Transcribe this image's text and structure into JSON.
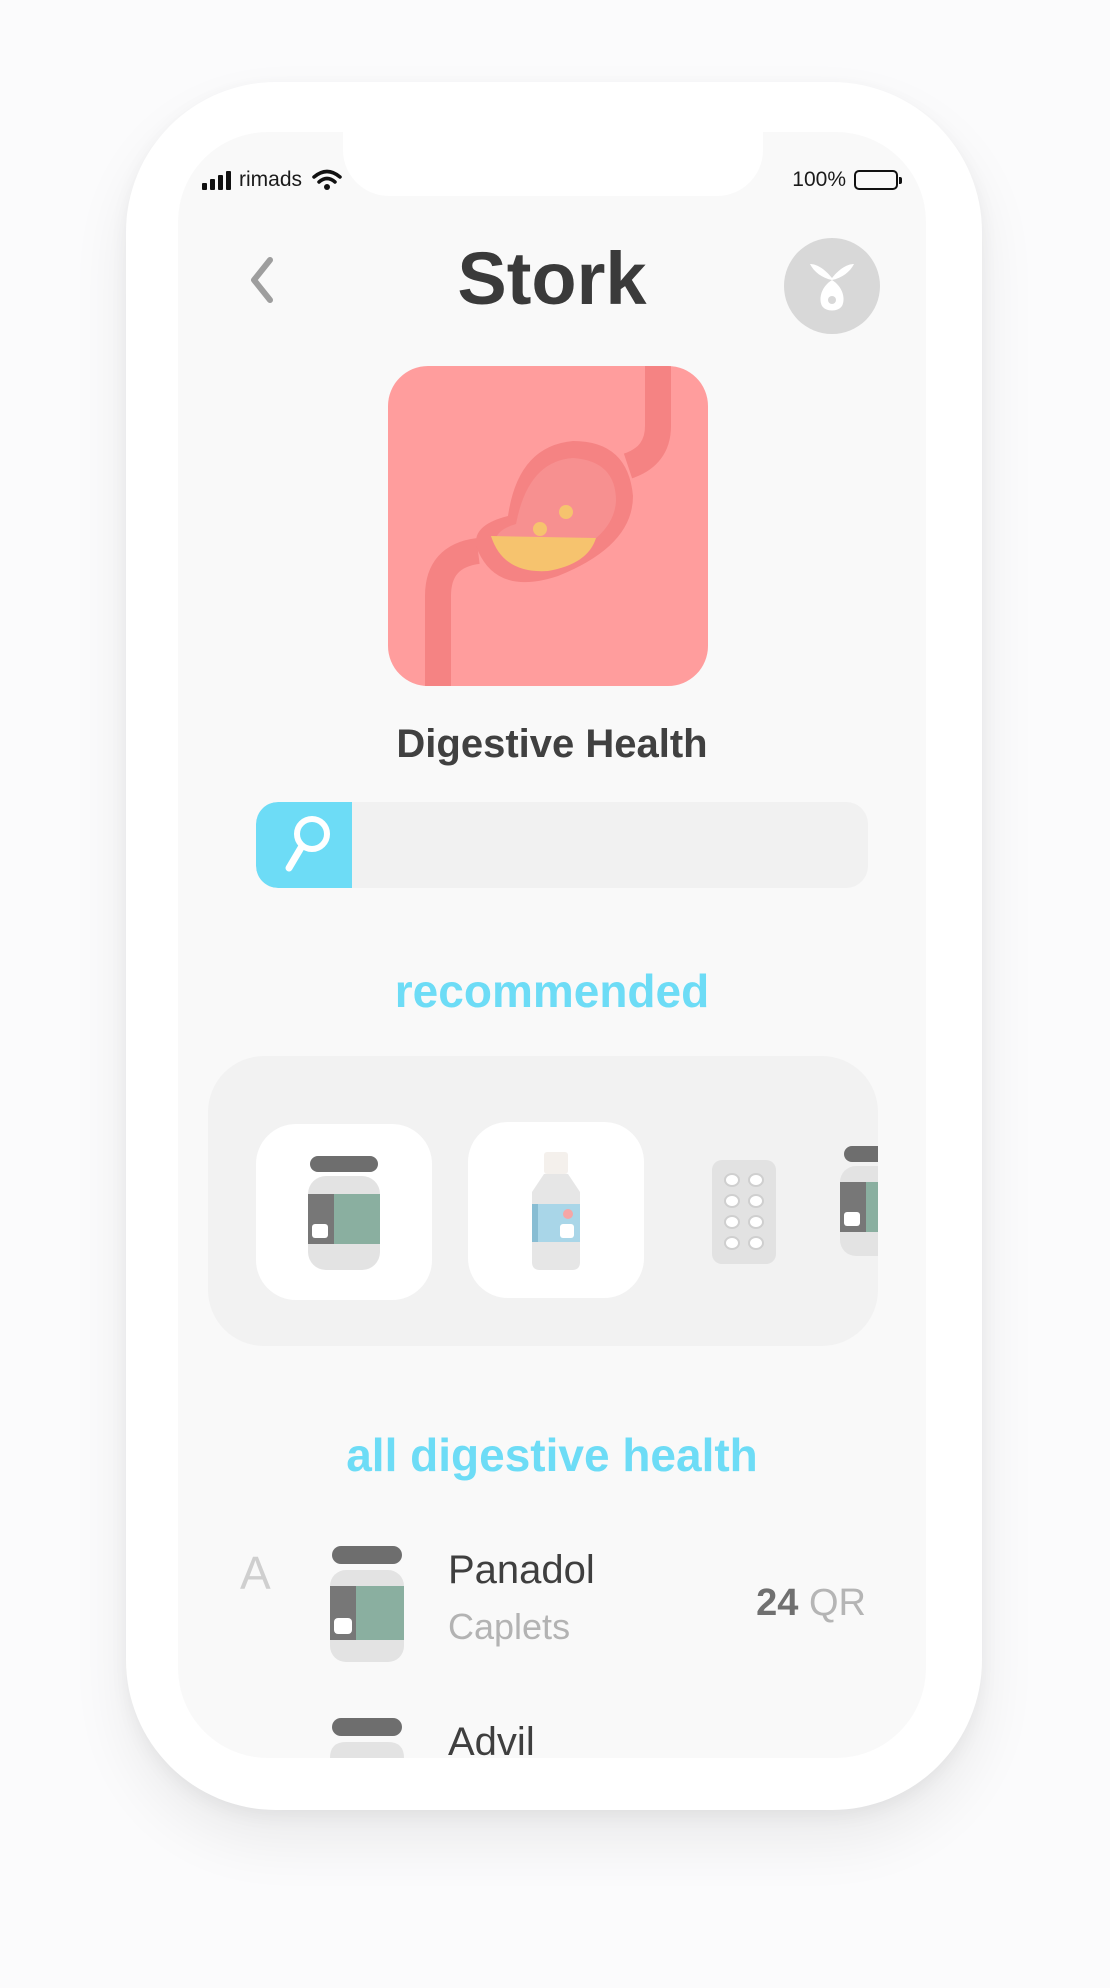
{
  "status_bar": {
    "carrier": "rimads",
    "battery": "100%"
  },
  "header": {
    "title": "Stork"
  },
  "category": {
    "name": "Digestive Health"
  },
  "search": {
    "placeholder": ""
  },
  "sections": {
    "recommended": "recommended",
    "all": "all digestive health"
  },
  "list": {
    "letter": "A",
    "items": [
      {
        "name": "Panadol",
        "form": "Caplets",
        "price": "24",
        "currency": "QR"
      },
      {
        "name": "Advil"
      }
    ]
  },
  "colors": {
    "accent": "#6ddcf6",
    "hero_bg": "#ff9d9d",
    "jar_band": "#8aafa0"
  }
}
